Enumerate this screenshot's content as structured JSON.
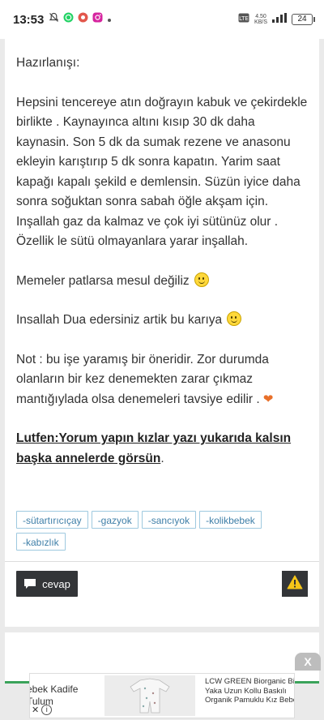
{
  "status_bar": {
    "time": "13:53",
    "network_top": "4.50",
    "network_bottom": "KB/S",
    "battery": "24",
    "icons": [
      "mute-icon",
      "whatsapp-icon",
      "app-icon",
      "instagram-icon",
      "dot-icon",
      "volte-icon",
      "signal-icon"
    ]
  },
  "post": {
    "heading": "Hazırlanışı:",
    "paragraph1": "Hepsini tencereye atın doğrayın kabuk ve çekirdekle birlikte . Kaynayınca altını kısıp 30 dk daha kaynasin. Son 5 dk da sumak rezene ve anasonu ekleyin karıştırıp 5 dk sonra kapatın. Yarim saat kapağı kapalı şekild e demlensin. Süzün iyice daha sonra soğuktan sonra sabah öğle akşam için.  Inşallah gaz da kalmaz ve çok iyi sütünüz olur . Özellik le sütü olmayanlara yarar inşallah.",
    "paragraph2": "Memeler patlarsa mesul değiliz",
    "paragraph3": "Insallah Dua edersiniz artik bu karıya",
    "paragraph4": "Not : bu işe yaramış bir öneridir.  Zor durumda olanların bir kez denemekten zarar çıkmaz mantığıylada olsa denemeleri tavsiye edilir .",
    "note": "Lutfen:Yorum yapın kızlar yazı yukarıda kalsın başka annelerde görsün",
    "note_suffix": "."
  },
  "tags": [
    "-sütartırıcıçay",
    "-gazyok",
    "-sancıyok",
    "-kolikbebek",
    "-kabızlık"
  ],
  "actions": {
    "reply_label": "cevap",
    "report_icon": "warning-icon"
  },
  "ad": {
    "close_label": "X",
    "left_line1": "ebek Kadife",
    "left_line2": "Tulum",
    "right_line1": "LCW GREEN Biorganic Bisi",
    "right_line2": "Yaka Uzun Kollu Baskılı",
    "right_line3": "Organik Pamuklu Kız Bebe",
    "controls_close": "✕",
    "controls_info": "i"
  },
  "colors": {
    "tag_border": "#9ec9df",
    "tag_text": "#3f7fa8",
    "button_bg": "#333538",
    "warning": "#f5c518",
    "accent_line": "#3aa35a"
  }
}
